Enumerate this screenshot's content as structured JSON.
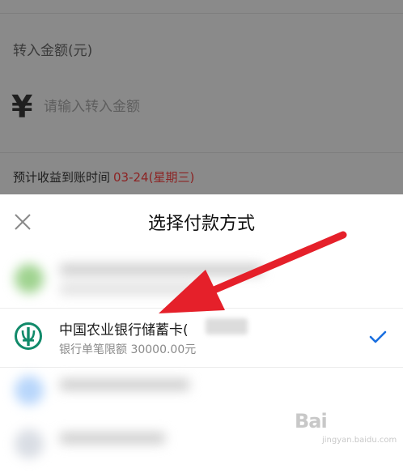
{
  "background": {
    "amount_label": "转入金额(元)",
    "currency_symbol": "¥",
    "amount_placeholder": "请输入转入金额",
    "arrival_label": "预计收益到账时间",
    "arrival_date": "03-24(星期三)"
  },
  "sheet": {
    "title": "选择付款方式",
    "selected_method": {
      "bank_name": "中国农业银行储蓄卡(",
      "limit_text": "银行单笔限额 30000.00元",
      "selected": true
    }
  },
  "icons": {
    "close": "close-icon",
    "bank_logo": "abc-bank-logo-icon",
    "checkmark": "checkmark-icon"
  },
  "watermark": {
    "main": "Bai",
    "sub": "jingyan.baidu.com"
  },
  "colors": {
    "accent_blue": "#1a6fe0",
    "abc_green": "#118a6a",
    "arrow_red": "#e5202a",
    "date_red": "#8c2323"
  }
}
